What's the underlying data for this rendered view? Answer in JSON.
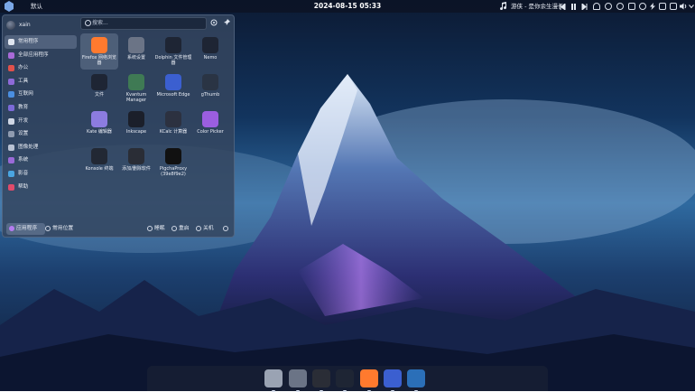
{
  "top_panel": {
    "workspace_label": "默认",
    "clock": "2024-08-15 05:33",
    "media_title": "游侠 - 是你余生漫长"
  },
  "menu": {
    "user_name": "xain",
    "search_placeholder": "搜索...",
    "sidebar": [
      {
        "label": "常用程序",
        "icon": "bookmark-icon",
        "color": "#dfe5ef",
        "active": true
      },
      {
        "label": "全部应用程序",
        "icon": "grid-icon",
        "color": "#a86ad8",
        "active": false
      },
      {
        "label": "办公",
        "icon": "office-icon",
        "color": "#e0514b",
        "active": false
      },
      {
        "label": "工具",
        "icon": "tools-icon",
        "color": "#8e6ad8",
        "active": false
      },
      {
        "label": "互联网",
        "icon": "internet-icon",
        "color": "#4a8ee0",
        "active": false
      },
      {
        "label": "教育",
        "icon": "education-icon",
        "color": "#7c6ad8",
        "active": false
      },
      {
        "label": "开发",
        "icon": "development-icon",
        "color": "#cfd6e4",
        "active": false
      },
      {
        "label": "设置",
        "icon": "settings-icon",
        "color": "#8f9bb0",
        "active": false
      },
      {
        "label": "图像处理",
        "icon": "graphics-icon",
        "color": "#b9c2d3",
        "active": false
      },
      {
        "label": "系统",
        "icon": "system-icon",
        "color": "#9a6ad8",
        "active": false
      },
      {
        "label": "影音",
        "icon": "multimedia-icon",
        "color": "#4aa5e0",
        "active": false
      },
      {
        "label": "帮助",
        "icon": "help-icon",
        "color": "#e04b6a",
        "active": false
      }
    ],
    "apps": [
      {
        "label": "Firefox 网络浏览器",
        "icon": "firefox-icon",
        "color": "#ff7a2e",
        "active": true
      },
      {
        "label": "系统设置",
        "icon": "system-settings-icon",
        "color": "#6b7486",
        "active": false
      },
      {
        "label": "Dolphin 文件管理器",
        "icon": "dolphin-icon",
        "color": "#1e2534",
        "active": false
      },
      {
        "label": "Nemo",
        "icon": "nemo-icon",
        "color": "#1e2534",
        "active": false
      },
      {
        "label": "文件",
        "icon": "files-icon",
        "color": "#1e2534",
        "active": false
      },
      {
        "label": "Kvantum Manager",
        "icon": "kvantum-icon",
        "color": "#3f7a54",
        "active": false
      },
      {
        "label": "Microsoft Edge",
        "icon": "edge-icon",
        "color": "#3b5fd0",
        "active": false
      },
      {
        "label": "gThumb",
        "icon": "gthumb-icon",
        "color": "#2a3444",
        "active": false
      },
      {
        "label": "Kate 编辑器",
        "icon": "kate-icon",
        "color": "#8c7ce0",
        "active": false
      },
      {
        "label": "Inkscape",
        "icon": "inkscape-icon",
        "color": "#1b1f2a",
        "active": false
      },
      {
        "label": "KCalc 计算器",
        "icon": "kcalc-icon",
        "color": "#2c3140",
        "active": false
      },
      {
        "label": "Color Picker",
        "icon": "color-picker-icon",
        "color": "#9b5ee0",
        "active": false
      },
      {
        "label": "Konsole 终端",
        "icon": "konsole-icon",
        "color": "#222834",
        "active": false
      },
      {
        "label": "添加/删除软件",
        "icon": "software-icon",
        "color": "#2a2d36",
        "active": false
      },
      {
        "label": "PigchaProxy (39e8f9e2)",
        "icon": "pigcha-icon",
        "color": "#111",
        "active": false
      }
    ],
    "footer": {
      "applications": "应用程序",
      "places": "常用位置",
      "sleep": "睡眠",
      "restart": "重启",
      "shutdown": "关机"
    }
  },
  "dock": {
    "items": [
      {
        "icon": "file-manager-icon",
        "color": "#9aa3b3"
      },
      {
        "icon": "settings-icon",
        "color": "#6b7486"
      },
      {
        "icon": "software-icon",
        "color": "#2a2d36"
      },
      {
        "icon": "folder-icon",
        "color": "#1e2534"
      },
      {
        "icon": "firefox-icon",
        "color": "#ff7a2e"
      },
      {
        "icon": "edge-icon",
        "color": "#3b5fd0"
      },
      {
        "icon": "weather-icon",
        "color": "#2b6fb8"
      }
    ]
  }
}
